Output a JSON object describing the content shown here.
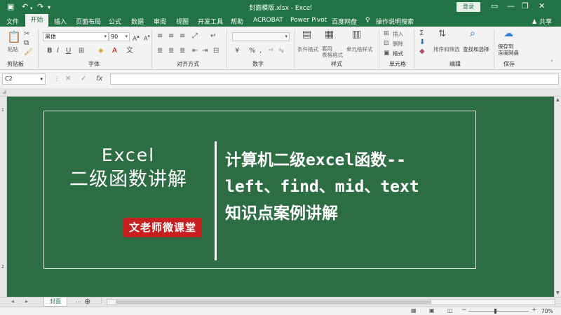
{
  "titlebar": {
    "file_title": "封面模版.xlsx  -  Excel",
    "login_label": "登录",
    "icons": [
      "save-icon",
      "undo-icon",
      "redo-icon",
      "customize-qa-icon",
      "ribbon-display-icon",
      "minimize-icon",
      "restore-icon",
      "close-icon"
    ]
  },
  "menu": {
    "tabs": [
      "文件",
      "开始",
      "插入",
      "页面布局",
      "公式",
      "数据",
      "审阅",
      "视图",
      "开发工具",
      "帮助",
      "ACROBAT",
      "Power Pivot",
      "百度网盘"
    ],
    "tell_me": "操作说明搜索",
    "share": "共享",
    "active": "开始"
  },
  "ribbon": {
    "groups": [
      "剪贴板",
      "字体",
      "对齐方式",
      "数字",
      "样式",
      "单元格",
      "编辑",
      "保存"
    ],
    "paste": "粘贴",
    "font_name": "黑体",
    "font_size": "90",
    "bold": "B",
    "italic": "I",
    "underline": "U",
    "conditional_format": "条件格式",
    "format_table": "套用\n表格格式",
    "cell_styles": "单元格样式",
    "insert": "插入",
    "delete": "删除",
    "format": "格式",
    "sort_filter": "排序和筛选",
    "find_select": "查找和选择",
    "save_to_baidu": "保存到\n百度网盘"
  },
  "formula_bar": {
    "name_box": "C2",
    "fx": "fx",
    "value": ""
  },
  "sheet": {
    "row_numbers": [
      "1",
      "2"
    ],
    "left_title_line1": "Excel",
    "left_title_line2": "二级函数讲解",
    "badge": "文老师微课堂",
    "right_title_lines": [
      "计算机二级excel函数--",
      "left、find、mid、text",
      "知识点案例讲解"
    ],
    "background_color": "#2d6d44"
  },
  "tabs": {
    "sheet_name": "封面"
  },
  "status": {
    "zoom": "70%",
    "zoom_level_percent": 70
  },
  "colors": {
    "accent": "#217346",
    "badge": "#c71f1f"
  }
}
